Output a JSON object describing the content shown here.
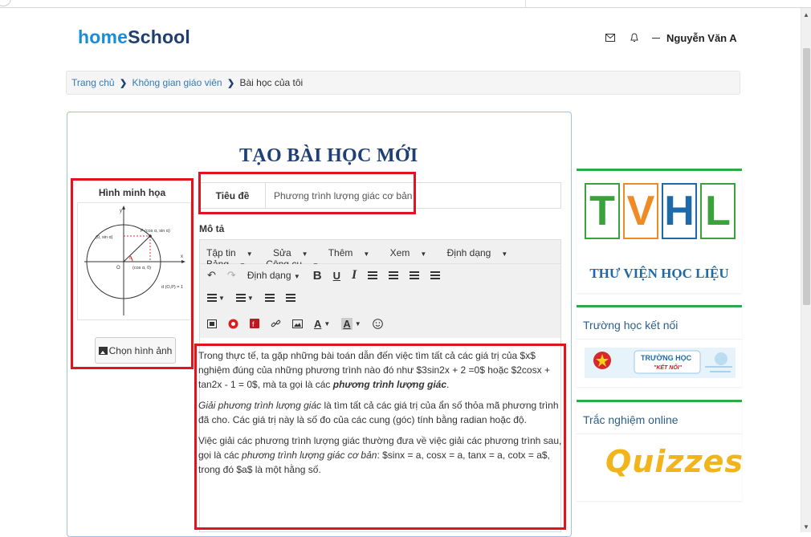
{
  "header": {
    "logo_home": "home",
    "logo_school": "School",
    "username": "Nguyễn Văn A"
  },
  "breadcrumb": {
    "items": [
      "Trang chủ",
      "Không gian giáo viên",
      "Bài học của tôi"
    ]
  },
  "page": {
    "title": "TẠO BÀI HỌC MỚI"
  },
  "illustration": {
    "heading": "Hình minh họa",
    "button": "Chọn hình ảnh",
    "diagram": {
      "label_y": "y",
      "label_x": "x",
      "label_o": "O",
      "label_p": "P (cos α, sin α)",
      "label_sin": "(0, sin α)",
      "label_cos": "(cos α, 0)",
      "label_alpha": "α",
      "label_d": "d (O,P) = 1"
    }
  },
  "form": {
    "title_label": "Tiêu đề",
    "title_value": "Phương trình lượng giác cơ bản",
    "desc_label": "Mô tả"
  },
  "editor": {
    "menu": [
      "Tập tin",
      "Sửa",
      "Thêm",
      "Xem",
      "Định dạng",
      "Bảng",
      "Công cụ"
    ],
    "format_dropdown": "Định dạng",
    "content": {
      "p1_a": "Trong thực tế, ta gặp những bài toán dẫn đến việc tìm tất cả các giá trị của $x$ nghiệm đúng của những phương trình nào đó như $3sin2x + 2 =0$ hoặc $2cosx + tan2x - 1 = 0$, mà ta gọi là các ",
      "p1_b": "phương trình lượng giác",
      "p1_c": ".",
      "p2_a": "Giải phương trình lượng giác",
      "p2_b": " là tìm tất cả các giá trị của ẩn số thỏa mã phương trình đã cho. Các giá trị này là số đo của các cung (góc) tính bằng radian hoặc độ.",
      "p3_a": "Việc giải các phương trình lượng giác thường đưa về việc giải các phương trình sau, gọi là các ",
      "p3_b": "phương trình lượng giác cơ bản",
      "p3_c": ":  $sinx = a, cosx = a, tanx = a, cotx = a$, trong đó $a$ là một hằng số."
    }
  },
  "sidebar": {
    "tvhl_letters": [
      "T",
      "V",
      "H",
      "L"
    ],
    "tvhl_caption": "THƯ VIỆN HỌC LIỆU",
    "school_title": "Trường học kết nối",
    "school_banner_main": "TRƯỜNG HỌC",
    "school_banner_sub": "\"KẾT NỐI\"",
    "quiz_title": "Trắc nghiệm online",
    "quiz_logo": "Quizzes"
  },
  "colors": {
    "brand_blue": "#1a8cd8",
    "title_navy": "#1f3f77",
    "highlight_red": "#e0141e",
    "side_green": "#2ea84a",
    "tvhl_green": "#3aa23a",
    "tvhl_orange": "#f08a24",
    "tvhl_blue": "#1e6aa8"
  }
}
